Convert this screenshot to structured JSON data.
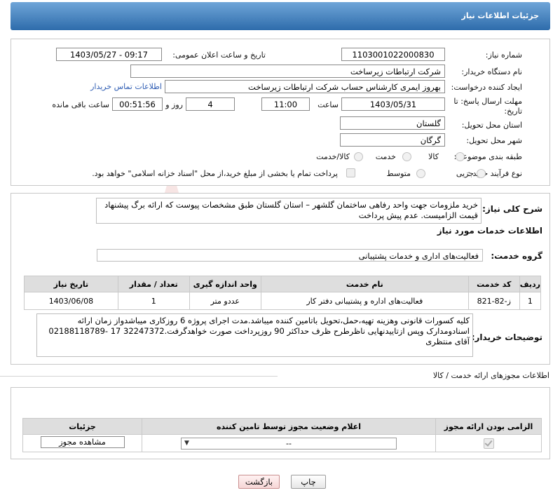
{
  "header": {
    "title": "جزئیات اطلاعات نیاز"
  },
  "need_number": {
    "label": "شماره نیاز:",
    "value": "1103001022000830"
  },
  "announce": {
    "label": "تاریخ و ساعت اعلان عمومی:",
    "value": "1403/05/27 - 09:17"
  },
  "buyer_org": {
    "label": "نام دستگاه خریدار:",
    "value": "شرکت ارتباطات زیرساخت"
  },
  "requester": {
    "label": "ایجاد کننده درخواست:",
    "value": "بهروز ایمری کارشناس حساب شرکت ارتباطات زیرساخت",
    "contact_link": "اطلاعات تماس خریدار"
  },
  "deadline": {
    "label_line1": "مهلت ارسال پاسخ: تا",
    "label_line2": "تاریخ:",
    "date": "1403/05/31",
    "time_label": "ساعت",
    "time": "11:00",
    "days": "4",
    "days_label": "روز و",
    "remaining": "00:51:56",
    "remaining_label": "ساعت باقی مانده"
  },
  "delivery_province": {
    "label": "استان محل تحویل:",
    "value": "گلستان"
  },
  "delivery_city": {
    "label": "شهر محل تحویل:",
    "value": "گرگان"
  },
  "category": {
    "label": "طبقه بندی موضوعی:",
    "options": [
      "کالا",
      "خدمت",
      "کالا/خدمت"
    ]
  },
  "process": {
    "label": "نوع فرآیند خرید :",
    "options": [
      "جزیی",
      "متوسط"
    ],
    "note": "پرداخت تمام یا بخشی از مبلغ خرید،از محل \"اسناد خزانه اسلامی\" خواهد بود."
  },
  "summary": {
    "label": "شرح کلی نیاز:",
    "text": "خرید ملزومات  جهت واحد رفاهی ساختمان گلشهر   –  استان گلستان   طبق مشخصات پیوست که ارائه برگ پیشنهاد قیمت الزامیست. عدم پیش پرداخت"
  },
  "services_info": {
    "title": "اطلاعات خدمات مورد نیاز"
  },
  "service_group": {
    "label": "گروه خدمت:",
    "value": "فعالیت‌های اداری و خدمات پشتیبانی"
  },
  "service_table": {
    "headers": [
      "ردیف",
      "کد خدمت",
      "نام خدمت",
      "واحد اندازه گیری",
      "تعداد / مقدار",
      "تاریخ نیاز"
    ],
    "rows": [
      {
        "row": "1",
        "code": "ز-82-821",
        "name": "فعالیت‌های اداره و پشتیبانی دفتر کار",
        "unit": "عددو متر",
        "qty": "1",
        "date": "1403/06/08"
      }
    ]
  },
  "buyer_notes": {
    "label": "توضیحات خریدار:",
    "text": "کلیه کسورات قانونی وهزینه تهیه،حمل،تحویل باتامین کننده میباشد.مدت اجرای پروژه 6 روزکاری میباشدواز زمان ارائه اسنادومدارک وپس ازتاییدنهایی ناظرطرح ظرف حداکثر 90 روزپرداخت صورت خواهدگرفت.32247372 17 -02188118789 آقای منتظری"
  },
  "permits": {
    "title": "اطلاعات مجوزهای ارائه خدمت / کالا",
    "headers": [
      "الزامی بودن ارائه مجوز",
      "اعلام وضعیت مجوز توسط تامین کننده",
      "جزئیات"
    ],
    "select_value": "--",
    "view_button": "مشاهده مجوز"
  },
  "footer": {
    "print": "چاپ",
    "back": "بازگشت"
  },
  "watermark": {
    "text": "AriaTender.neT"
  }
}
